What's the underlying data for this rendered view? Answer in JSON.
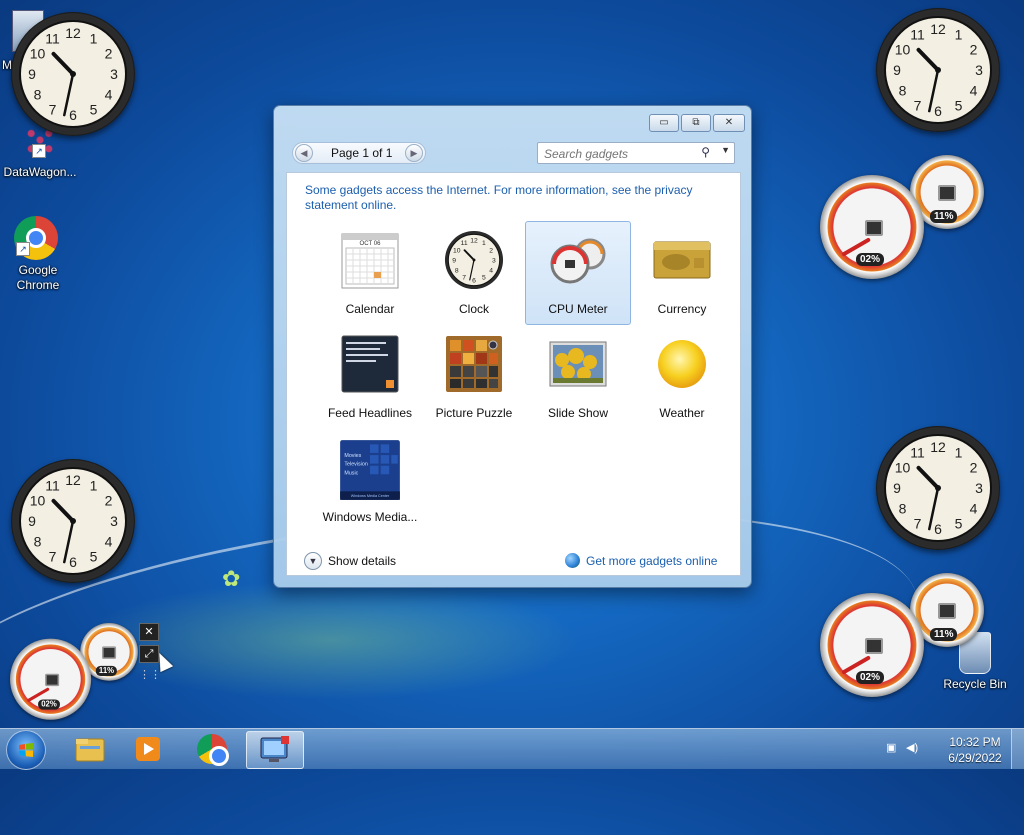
{
  "desktop": {
    "icons": [
      {
        "label": "M",
        "icon": "computer-icon"
      },
      {
        "label": "DataWagon...",
        "icon": "datawagon-icon"
      },
      {
        "label": "Google Chrome",
        "icon": "chrome-icon"
      },
      {
        "label": "Recycle Bin",
        "icon": "recycle-bin-icon"
      }
    ]
  },
  "cpu_meters": [
    {
      "cpu": "02%",
      "memory": "11%"
    },
    {
      "cpu": "02%",
      "memory": "11%"
    },
    {
      "cpu": "02%",
      "memory": "11%"
    }
  ],
  "gallery": {
    "pager_label": "Page 1 of 1",
    "search_placeholder": "Search gadgets",
    "info_text": "Some gadgets access the Internet.  For more information, see the privacy statement online.",
    "gadgets": [
      {
        "name": "Calendar",
        "icon": "calendar-icon"
      },
      {
        "name": "Clock",
        "icon": "clock-icon"
      },
      {
        "name": "CPU Meter",
        "icon": "cpu-meter-icon",
        "selected": true
      },
      {
        "name": "Currency",
        "icon": "currency-icon"
      },
      {
        "name": "Feed Headlines",
        "icon": "feed-headlines-icon"
      },
      {
        "name": "Picture Puzzle",
        "icon": "picture-puzzle-icon"
      },
      {
        "name": "Slide Show",
        "icon": "slide-show-icon"
      },
      {
        "name": "Weather",
        "icon": "weather-icon"
      },
      {
        "name": "Windows Media...",
        "icon": "windows-media-icon"
      }
    ],
    "calendar_month": "OCT 06",
    "media_menu": [
      "Movies",
      "Television",
      "Music"
    ],
    "media_footer": "Windows Media Center",
    "show_details_label": "Show details",
    "get_more_label": "Get more gadgets online"
  },
  "taskbar": {
    "apps": [
      "file-explorer-icon",
      "media-player-icon",
      "chrome-icon",
      "gadget-gallery-icon"
    ],
    "time": "10:32 PM",
    "date": "6/29/2022"
  },
  "colors": {
    "link": "#1c5fae",
    "selection": "#cfe3f7",
    "desktop": "#1467c0"
  }
}
